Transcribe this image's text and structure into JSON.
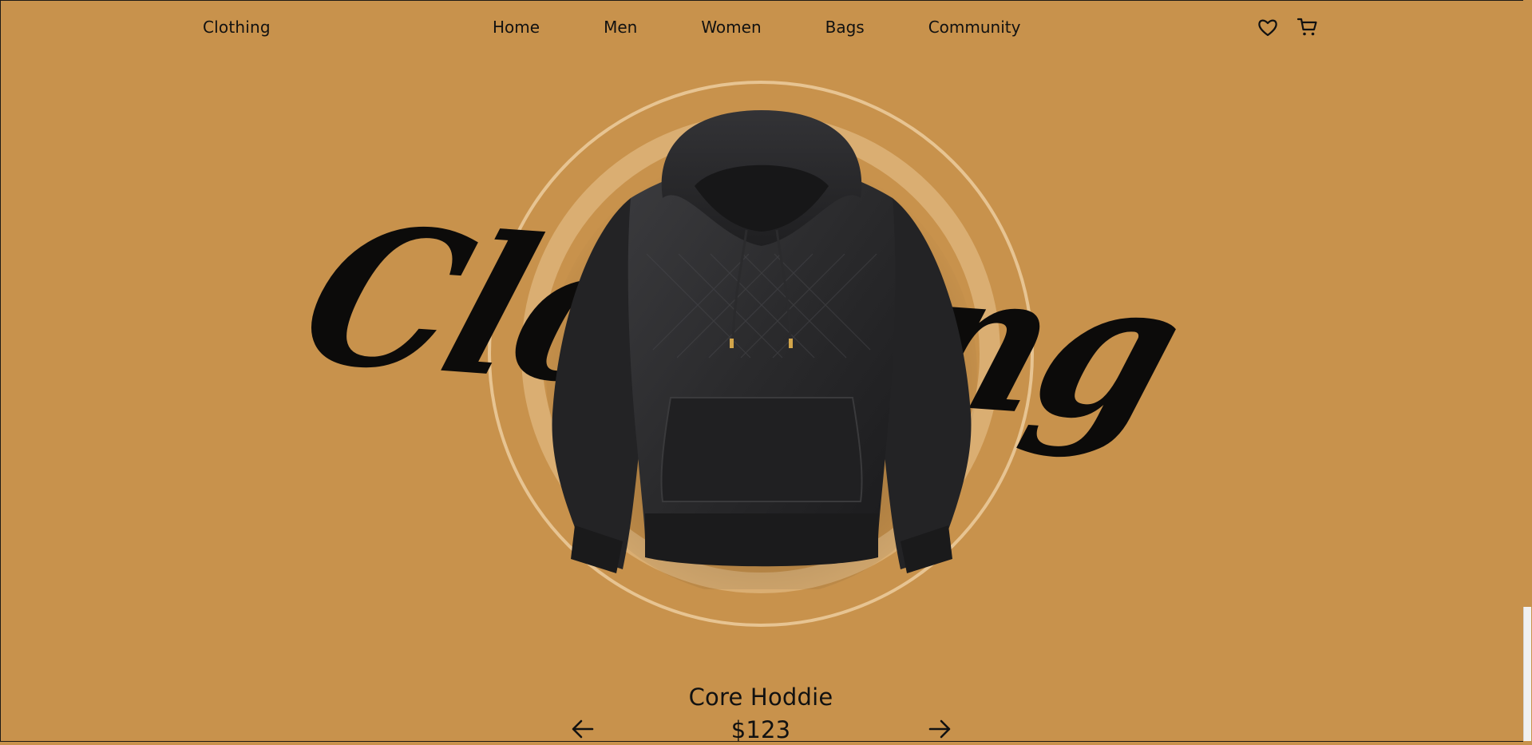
{
  "nav": {
    "brand": "Clothing",
    "links": [
      {
        "label": "Home"
      },
      {
        "label": "Men"
      },
      {
        "label": "Women"
      },
      {
        "label": "Bags"
      },
      {
        "label": "Community"
      }
    ],
    "icons": [
      "heart-icon",
      "cart-icon"
    ]
  },
  "hero": {
    "script_word": "Clothing"
  },
  "product": {
    "name": "Core Hoddie",
    "price": "$123"
  },
  "colors": {
    "background": "#c8924c",
    "text": "#111111",
    "ring": "#f2d4aa",
    "garment": "#2a2a2c"
  }
}
